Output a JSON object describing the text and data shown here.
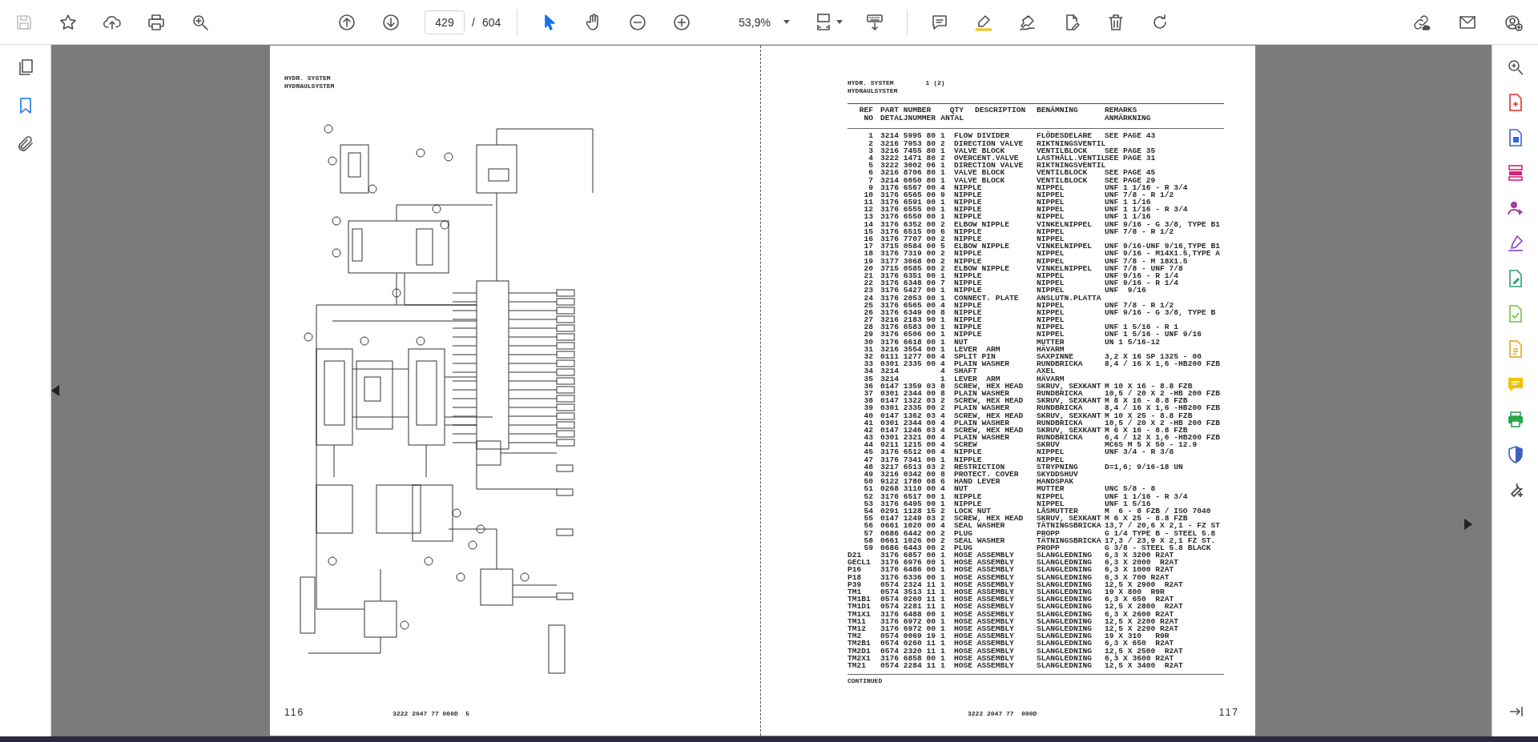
{
  "toolbar": {
    "save_button": {
      "disabled": true
    },
    "page_current": "429",
    "page_separator": "/",
    "page_total": "604",
    "tools": [
      {
        "selected": true
      },
      {
        "selected": false
      }
    ],
    "zoom_value": "53,9%"
  },
  "left_page": {
    "title": "HYDR. SYSTEM",
    "subtitle": "HYDRAULSYSTEM",
    "page_number": "116",
    "footer_code": "3222 2047 77 000D  5"
  },
  "right_page": {
    "title": "HYDR. SYSTEM",
    "sheet": "1 (2)",
    "subtitle": "HYDRAULSYSTEM",
    "columns": [
      {
        "title": "REF",
        "subtitle": "NO"
      },
      {
        "title": "PART NUMBER",
        "subtitle": "DETALJNUMMER"
      },
      {
        "title": "QTY",
        "subtitle": "ANTAL"
      },
      {
        "title": "DESCRIPTION"
      },
      {
        "title": "BENÄMNING"
      },
      {
        "title": "REMARKS",
        "subtitle": "ANMÄRKNING"
      }
    ],
    "rows": [
      {
        "kind": "item",
        "cells": [
          "1",
          "3214 5995 80",
          "1",
          "FLOW DIVIDER",
          "FLÖDESDELARE",
          "SEE PAGE 43"
        ]
      },
      {
        "kind": "item",
        "cells": [
          "2",
          "3216 7953 80",
          "2",
          "DIRECTION VALVE",
          "RIKTNINGSVENTIL"
        ]
      },
      {
        "kind": "item",
        "cells": [
          "3",
          "3216 7455 80",
          "1",
          "VALVE BLOCK",
          "VENTILBLOCK",
          "SEE PAGE 35"
        ]
      },
      {
        "kind": "item",
        "cells": [
          "4",
          "3222 1471 80",
          "2",
          "OVERCENT.VALVE",
          "LASTHÅLL.VENTIL",
          "SEE PAGE 31"
        ]
      },
      {
        "kind": "item",
        "cells": [
          "5",
          "3222 3002 06",
          "1",
          "DIRECTION VALVE",
          "RIKTNINGSVENTIL"
        ]
      },
      {
        "kind": "item",
        "cells": [
          "6",
          "3216 8706 80",
          "1",
          "VALVE BLOCK",
          "VENTILBLOCK",
          "SEE PAGE 45"
        ]
      },
      {
        "kind": "item",
        "cells": [
          "7",
          "3214 6050 80",
          "1",
          "VALVE BLOCK",
          "VENTILBLOCK",
          "SEE PAGE 29"
        ]
      },
      {
        "kind": "item",
        "cells": [
          "9",
          "3176 6567 00",
          "4",
          "NIPPLE",
          "NIPPEL",
          "UNF 1 1/16 - R 3/4"
        ]
      },
      {
        "kind": "item",
        "cells": [
          "10",
          "3176 6565 00",
          "9",
          "NIPPLE",
          "NIPPEL",
          "UNF 7/8 - R 1/2"
        ]
      },
      {
        "kind": "item",
        "cells": [
          "11",
          "3176 6591 00",
          "1",
          "NIPPLE",
          "NIPPEL",
          "UNF 1 1/16"
        ]
      },
      {
        "kind": "item",
        "cells": [
          "12",
          "3176 6555 00",
          "1",
          "NIPPLE",
          "NIPPEL",
          "UNF 1 1/16 - R 3/4"
        ]
      },
      {
        "kind": "item",
        "cells": [
          "13",
          "3176 6550 00",
          "1",
          "NIPPLE",
          "NIPPEL",
          "UNF 1 1/16"
        ]
      },
      {
        "kind": "item",
        "cells": [
          "14",
          "3176 6352 00",
          "2",
          "ELBOW NIPPLE",
          "VINKELNIPPEL",
          "UNF 9/16 - G 3/8, TYPE B1"
        ]
      },
      {
        "kind": "item",
        "cells": [
          "15",
          "3176 6515 00",
          "6",
          "NIPPLE",
          "NIPPEL",
          "UNF 7/8 - R 1/2"
        ]
      },
      {
        "kind": "item",
        "cells": [
          "16",
          "3176 7707 00",
          "2",
          "NIPPLE",
          "NIPPEL"
        ]
      },
      {
        "kind": "item",
        "cells": [
          "17",
          "3715 0584 00",
          "5",
          "ELBOW NIPPLE",
          "VINKELNIPPEL",
          "UNF 9/16-UNF 9/16,TYPE B1"
        ]
      },
      {
        "kind": "item",
        "cells": [
          "18",
          "3176 7319 00",
          "2",
          "NIPPLE",
          "NIPPEL",
          "UNF 9/16 - M14X1.5,TYPE A"
        ]
      },
      {
        "kind": "item",
        "cells": [
          "19",
          "3177 3068 00",
          "2",
          "NIPPLE",
          "NIPPEL",
          "UNF 7/8 - M 18X1.5"
        ]
      },
      {
        "kind": "item",
        "cells": [
          "20",
          "3715 0585 00",
          "2",
          "ELBOW NIPPLE",
          "VINKELNIPPEL",
          "UNF 7/8 - UNF 7/8"
        ]
      },
      {
        "kind": "item",
        "cells": [
          "21",
          "3176 6351 00",
          "1",
          "NIPPLE",
          "NIPPEL",
          "UNF 9/16 - R 1/4"
        ]
      },
      {
        "kind": "item",
        "cells": [
          "22",
          "3176 6348 00",
          "7",
          "NIPPLE",
          "NIPPEL",
          "UNF 9/16 - R 1/4"
        ]
      },
      {
        "kind": "item",
        "cells": [
          "23",
          "3176 5427 00",
          "1",
          "NIPPLE",
          "NIPPEL",
          "UNF  9/16"
        ]
      },
      {
        "kind": "item",
        "cells": [
          "24",
          "3176 2053 00",
          "1",
          "CONNECT. PLATE",
          "ANSLUTN.PLATTA"
        ]
      },
      {
        "kind": "item",
        "cells": [
          "25",
          "3176 6565 00",
          "4",
          "NIPPLE",
          "NIPPEL",
          "UNF 7/8 - R 1/2"
        ]
      },
      {
        "kind": "item",
        "cells": [
          "26",
          "3176 6349 00",
          "8",
          "NIPPLE",
          "NIPPEL",
          "UNF 9/16 - G 3/8, TYPE B"
        ]
      },
      {
        "kind": "item",
        "cells": [
          "27",
          "3216 2183 90",
          "1",
          "NIPPLE",
          "NIPPEL"
        ]
      },
      {
        "kind": "item",
        "cells": [
          "28",
          "3176 6583 00",
          "1",
          "NIPPLE",
          "NIPPEL",
          "UNF 1 5/16 - R 1"
        ]
      },
      {
        "kind": "item",
        "cells": [
          "29",
          "3176 6506 00",
          "1",
          "NIPPLE",
          "NIPPEL",
          "UNF 1 5/16 - UNF 9/16"
        ]
      },
      {
        "kind": "item",
        "cells": [
          "30",
          "3176 6618 00",
          "1",
          "NUT",
          "MUTTER",
          "UN 1 5/16-12"
        ]
      },
      {
        "kind": "item",
        "cells": [
          "31",
          "3216 3554 00",
          "1",
          "LEVER  ARM",
          "HÄVARM"
        ]
      },
      {
        "kind": "item",
        "cells": [
          "32",
          "0111 1277 00",
          "4",
          "SPLIT PIN",
          "SAXPINNE",
          "3,2 X 16 SP 1325 - 00"
        ]
      },
      {
        "kind": "item",
        "cells": [
          "33",
          "0301 2335 00",
          "4",
          "PLAIN WASHER",
          "RUNDBRICKA",
          "8,4 / 16 X 1,6 -HB200 FZB"
        ]
      },
      {
        "kind": "item",
        "cells": [
          "34",
          "3214",
          "4",
          "SHAFT",
          "AXEL"
        ]
      },
      {
        "kind": "item",
        "cells": [
          "35",
          "3214",
          "1",
          "LEVER  ARM",
          "HÄVARM"
        ]
      },
      {
        "kind": "item",
        "cells": [
          "36",
          "0147 1359 03",
          "8",
          "SCREW, HEX HEAD",
          "SKRUV, SEXKANT",
          "M 10 X 16 - 8.8 FZB"
        ]
      },
      {
        "kind": "item",
        "cells": [
          "37",
          "0301 2344 00",
          "8",
          "PLAIN WASHER",
          "RUNDBRICKA",
          "10,5 / 20 X 2 -HB 200 FZB"
        ]
      },
      {
        "kind": "item",
        "cells": [
          "38",
          "0147 1322 03",
          "2",
          "SCREW, HEX HEAD",
          "SKRUV, SEXKANT",
          "M 8 X 16 - 8.8 FZB"
        ]
      },
      {
        "kind": "item",
        "cells": [
          "39",
          "0301 2335 00",
          "2",
          "PLAIN WASHER",
          "RUNDBRICKA",
          "8,4 / 16 X 1,6 -HB200 FZB"
        ]
      },
      {
        "kind": "item",
        "cells": [
          "40",
          "0147 1362 03",
          "4",
          "SCREW, HEX HEAD",
          "SKRUV, SEXKANT",
          "M 10 X 25 - 8.8 FZB"
        ]
      },
      {
        "kind": "item",
        "cells": [
          "41",
          "0301 2344 00",
          "4",
          "PLAIN WASHER",
          "RUNDBRICKA",
          "10,5 / 20 X 2 -HB 200 FZB"
        ]
      },
      {
        "kind": "item",
        "cells": [
          "42",
          "0147 1246 03",
          "4",
          "SCREW, HEX HEAD",
          "SKRUV, SEXKANT",
          "M 6 X 16 - 8.8 FZB"
        ]
      },
      {
        "kind": "item",
        "cells": [
          "43",
          "0301 2321 00",
          "4",
          "PLAIN WASHER",
          "RUNDBRICKA",
          "6,4 / 12 X 1,6 -HB200 FZB"
        ]
      },
      {
        "kind": "item",
        "cells": [
          "44",
          "0211 1215 00",
          "4",
          "SCREW",
          "SKRUV",
          "MC6S M 5 X 50 - 12.9"
        ]
      },
      {
        "kind": "item",
        "cells": [
          "45",
          "3176 6512 00",
          "4",
          "NIPPLE",
          "NIPPEL",
          "UNF 3/4 - R 3/8"
        ]
      },
      {
        "kind": "item",
        "cells": [
          "47",
          "3176 7341 00",
          "1",
          "NIPPLE",
          "NIPPEL"
        ]
      },
      {
        "kind": "item",
        "cells": [
          "48",
          "3217 6513 03",
          "2",
          "RESTRICTION",
          "STRYPNING",
          "D=1,6; 9/16-18 UN"
        ]
      },
      {
        "kind": "item",
        "cells": [
          "49",
          "3216 0342 00",
          "8",
          "PROTECT. COVER",
          "SKYDDSHUV"
        ]
      },
      {
        "kind": "item",
        "cells": [
          "50",
          "9122 1780 08",
          "6",
          "HAND LEVER",
          "HANDSPAK"
        ]
      },
      {
        "kind": "item",
        "cells": [
          "51",
          "0268 3110 00",
          "4",
          "NUT",
          "MUTTER",
          "UNC 5/8 - 8"
        ]
      },
      {
        "kind": "item",
        "cells": [
          "52",
          "3176 6517 00",
          "1",
          "NIPPLE",
          "NIPPEL",
          "UNF 1 1/16 - R 3/4"
        ]
      },
      {
        "kind": "item",
        "cells": [
          "53",
          "3176 6495 00",
          "1",
          "NIPPLE",
          "NIPPEL",
          "UNF 1 5/16"
        ]
      },
      {
        "kind": "item",
        "cells": [
          "54",
          "0291 1128 15",
          "2",
          "LOCK NUT",
          "LÅSMUTTER",
          "M  6 - 8 FZB / ISO 7040"
        ]
      },
      {
        "kind": "item",
        "cells": [
          "55",
          "0147 1249 03",
          "2",
          "SCREW, HEX HEAD",
          "SKRUV, SEXKANT",
          "M 6 X 25 - 8.8 FZB"
        ]
      },
      {
        "kind": "item",
        "cells": [
          "56",
          "0661 1020 00",
          "4",
          "SEAL WASHER",
          "TÄTNINGSBRICKA",
          "13,7 / 20,6 X 2,1 - FZ ST"
        ]
      },
      {
        "kind": "item",
        "cells": [
          "57",
          "0686 6442 00",
          "2",
          "PLUG",
          "PROPP",
          "G 1/4 TYPE B - STEEL 5.8"
        ]
      },
      {
        "kind": "item",
        "cells": [
          "58",
          "0661 1026 00",
          "2",
          "SEAL WASHER",
          "TÄTNINGSBRICKA",
          "17,3 / 23,9 X 2,1 FZ ST."
        ]
      },
      {
        "kind": "item",
        "cells": [
          "59",
          "0686 6443 00",
          "2",
          "PLUG",
          "PROPP",
          "G 3/8 - STEEL 5.8 BLACK"
        ]
      },
      {
        "kind": "hose",
        "cells": [
          "D21",
          "3176 6857 00",
          "1",
          "HOSE ASSEMBLY",
          "SLANGLEDNING",
          "6,3 X 3200 R2AT"
        ]
      },
      {
        "kind": "hose",
        "cells": [
          "GECL1",
          "3176 6976 00",
          "1",
          "HOSE ASSEMBLY",
          "SLANGLEDNING",
          "6,3 X 2000  R2AT"
        ]
      },
      {
        "kind": "hose",
        "cells": [
          "P16",
          "3176 6486 00",
          "1",
          "HOSE ASSEMBLY",
          "SLANGLEDNING",
          "6,3 X 1000 R2AT"
        ]
      },
      {
        "kind": "hose",
        "cells": [
          "P18",
          "3176 6336 00",
          "1",
          "HOSE ASSEMBLY",
          "SLANGLEDNING",
          "6,3 X 700 R2AT"
        ]
      },
      {
        "kind": "hose",
        "cells": [
          "P39",
          "0574 2324 11",
          "1",
          "HOSE ASSEMBLY",
          "SLANGLEDNING",
          "12,5 X 2900  R2AT"
        ]
      },
      {
        "kind": "hose",
        "cells": [
          "TM1",
          "0574 3513 11",
          "1",
          "HOSE ASSEMBLY",
          "SLANGLEDNING",
          "19 X 800  R9R"
        ]
      },
      {
        "kind": "hose",
        "cells": [
          "TM1B1",
          "0574 0260 11",
          "1",
          "HOSE ASSEMBLY",
          "SLANGLEDNING",
          "6,3 X 650  R2AT"
        ]
      },
      {
        "kind": "hose",
        "cells": [
          "TM1D1",
          "0574 2281 11",
          "1",
          "HOSE ASSEMBLY",
          "SLANGLEDNING",
          "12,5 X 2800  R2AT"
        ]
      },
      {
        "kind": "hose",
        "cells": [
          "TM1X1",
          "3176 6488 00",
          "1",
          "HOSE ASSEMBLY",
          "SLANGLEDNING",
          "6,3 X 2600 R2AT"
        ]
      },
      {
        "kind": "hose",
        "cells": [
          "TM11",
          "3176 6972 00",
          "1",
          "HOSE ASSEMBLY",
          "SLANGLEDNING",
          "12,5 X 2200 R2AT"
        ]
      },
      {
        "kind": "hose",
        "cells": [
          "TM12",
          "3176 6972 00",
          "1",
          "HOSE ASSEMBLY",
          "SLANGLEDNING",
          "12,5 X 2200 R2AT"
        ]
      },
      {
        "kind": "hose",
        "cells": [
          "TM2",
          "0574 0069 19",
          "1",
          "HOSE ASSEMBLY",
          "SLANGLEDNING",
          "19 X 310   R9R"
        ]
      },
      {
        "kind": "hose",
        "cells": [
          "TM2B1",
          "0574 0260 11",
          "1",
          "HOSE ASSEMBLY",
          "SLANGLEDNING",
          "6,3 X 650  R2AT"
        ]
      },
      {
        "kind": "hose",
        "cells": [
          "TM2D1",
          "0574 2320 11",
          "1",
          "HOSE ASSEMBLY",
          "SLANGLEDNING",
          "12,5 X 2500  R2AT"
        ]
      },
      {
        "kind": "hose",
        "cells": [
          "TM2X1",
          "3176 6858 00",
          "1",
          "HOSE ASSEMBLY",
          "SLANGLEDNING",
          "6,3 X 3600 R2AT"
        ]
      },
      {
        "kind": "hose",
        "cells": [
          "TM21",
          "0574 2284 11",
          "1",
          "HOSE ASSEMBLY",
          "SLANGLEDNING",
          "12,5 X 3400  R2AT"
        ]
      }
    ],
    "continued": "CONTINUED",
    "footer_code": "3222 2047 77  000D",
    "page_number": "117"
  }
}
